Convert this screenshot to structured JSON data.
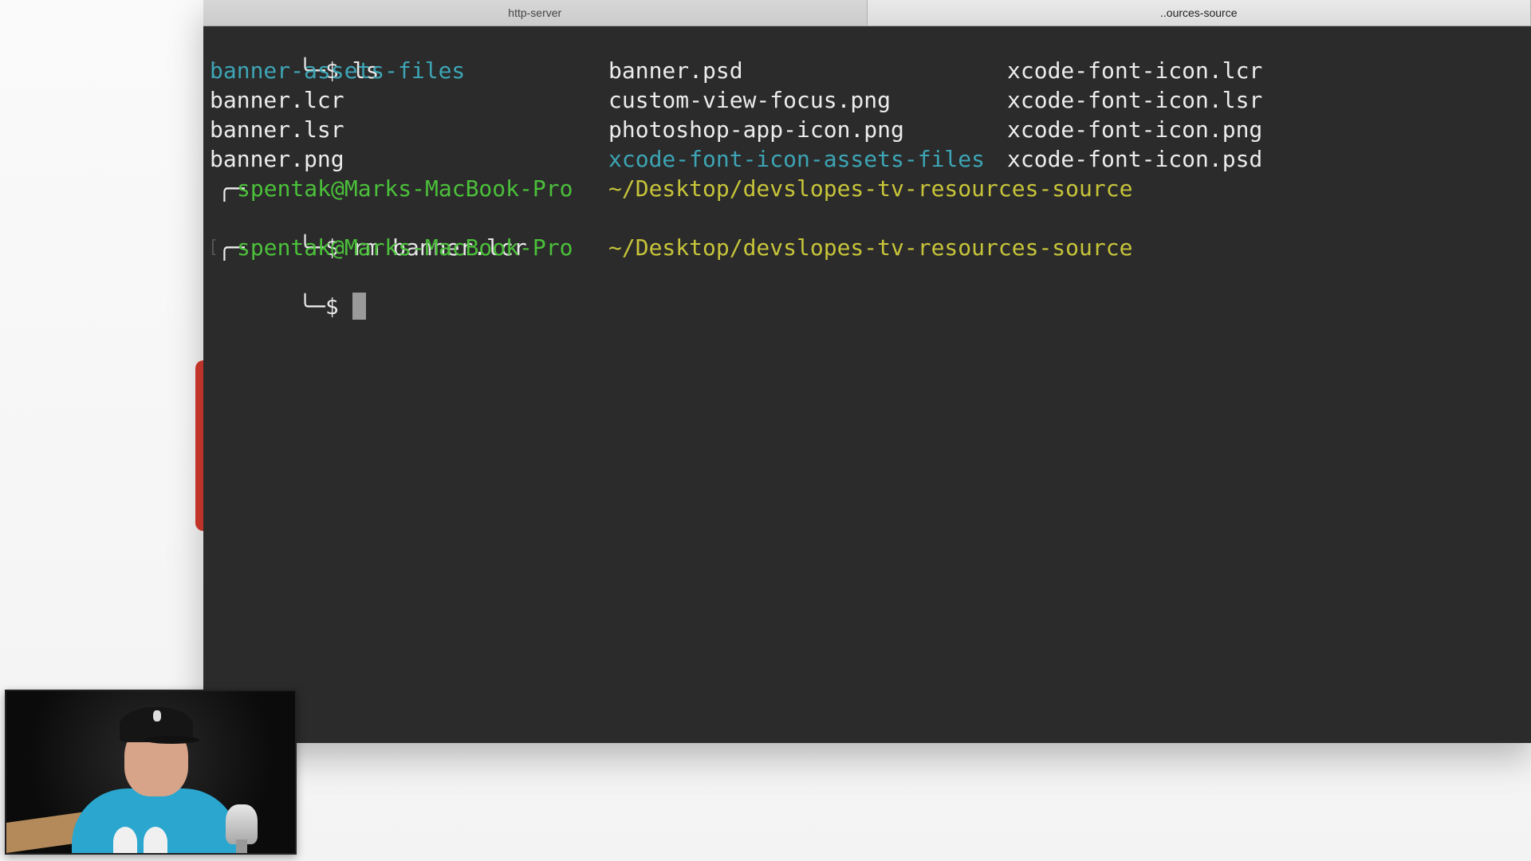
{
  "tabs": [
    {
      "label": "http-server",
      "active": false
    },
    {
      "label": "..ources-source",
      "active": true
    }
  ],
  "terminal": {
    "prompt_symbol": "╰─$",
    "prompt_top": "╭─",
    "user_host": "spentak@Marks-MacBook-Pro",
    "cwd": "~/Desktop/devslopes-tv-resources-source",
    "cmd1": "ls",
    "cmd2": "rm banner.lcr",
    "listing": {
      "col1": [
        "banner-assets-files",
        "banner.lcr",
        "banner.lsr",
        "banner.png"
      ],
      "col2": [
        "banner.psd",
        "custom-view-focus.png",
        "photoshop-app-icon.png",
        "xcode-font-icon-assets-files"
      ],
      "col3": [
        "xcode-font-icon.lcr",
        "xcode-font-icon.lsr",
        "xcode-font-icon.png",
        "xcode-font-icon.psd"
      ]
    },
    "colors": {
      "directory": "#3da5b5",
      "user_host": "#4bc03a",
      "path": "#c7c43a",
      "text": "#e8e8e8",
      "background": "#2b2b2b"
    }
  },
  "webcam": {
    "description_icon": "presenter-webcam-icon"
  }
}
